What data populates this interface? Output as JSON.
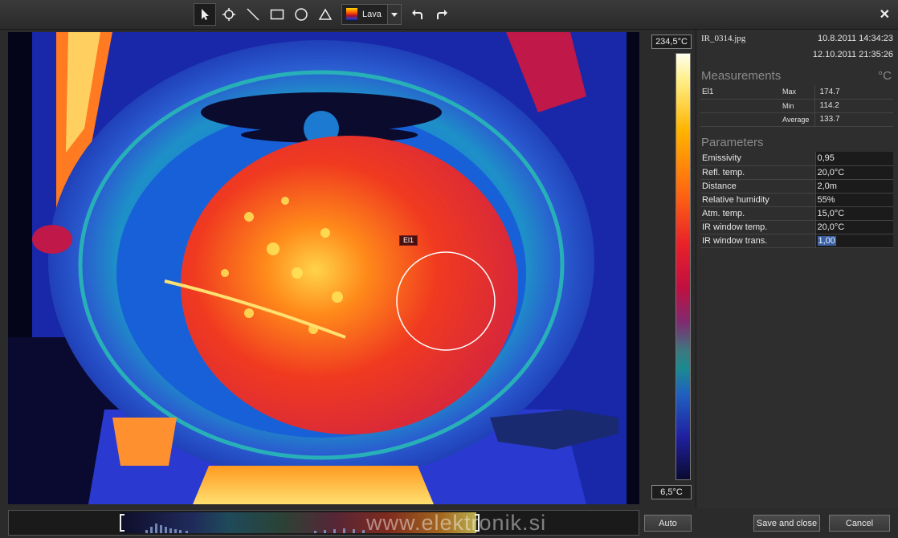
{
  "toolbar": {
    "tools": [
      {
        "name": "select-tool",
        "icon": "cursor-icon"
      },
      {
        "name": "spot-tool",
        "icon": "crosshair-icon"
      },
      {
        "name": "line-tool",
        "icon": "line-icon"
      },
      {
        "name": "rectangle-tool",
        "icon": "rectangle-icon"
      },
      {
        "name": "ellipse-tool",
        "icon": "circle-icon"
      },
      {
        "name": "triangle-tool",
        "icon": "triangle-icon"
      }
    ],
    "palette_label": "Lava",
    "undo_icon": "undo-icon",
    "redo_icon": "redo-icon",
    "close_label": "✕"
  },
  "image": {
    "roi_label": "El1"
  },
  "scale": {
    "max": "234,5°C",
    "min": "6,5°C"
  },
  "panel": {
    "file_name": "IR_0314.jpg",
    "date_taken": "10.8.2011 14:34:23",
    "date_modified": "12.10.2011 21:35:26",
    "measurements_title": "Measurements",
    "unit": "°C",
    "measurements": [
      {
        "name": "El1",
        "label": "Max",
        "value": "174.7"
      },
      {
        "name": "",
        "label": "Min",
        "value": "114.2"
      },
      {
        "name": "",
        "label": "Average",
        "value": "133.7"
      }
    ],
    "parameters_title": "Parameters",
    "parameters": [
      {
        "label": "Emissivity",
        "value": "0,95"
      },
      {
        "label": "Refl. temp.",
        "value": "20,0°C"
      },
      {
        "label": "Distance",
        "value": "2,0m"
      },
      {
        "label": "Relative humidity",
        "value": "55%"
      },
      {
        "label": "Atm. temp.",
        "value": "15,0°C"
      },
      {
        "label": "IR window temp.",
        "value": "20,0°C"
      },
      {
        "label": "IR window trans.",
        "value": "1,00"
      }
    ]
  },
  "bottom": {
    "watermark": "www.elektronik.si",
    "auto_label": "Auto",
    "save_label": "Save and close",
    "cancel_label": "Cancel"
  }
}
